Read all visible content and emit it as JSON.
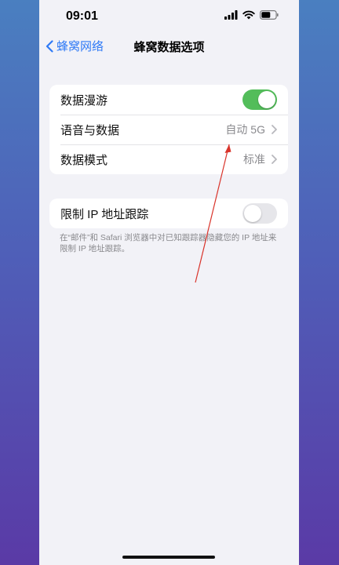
{
  "status_bar": {
    "time": "09:01"
  },
  "nav": {
    "back_label": "蜂窝网络",
    "title": "蜂窝数据选项"
  },
  "group1": {
    "data_roaming": {
      "label": "数据漫游",
      "toggle_on": true
    },
    "voice_data": {
      "label": "语音与数据",
      "value": "自动 5G"
    },
    "data_mode": {
      "label": "数据模式",
      "value": "标准"
    }
  },
  "group2": {
    "limit_ip": {
      "label": "限制 IP 地址跟踪",
      "toggle_on": false
    }
  },
  "footnote": "在“邮件”和 Safari 浏览器中对已知跟踪器隐藏您的 IP 地址来限制 IP 地址跟踪。",
  "colors": {
    "accent": "#2f7af6",
    "toggle_on": "#53bd5a",
    "annotation_arrow": "#d9342b"
  }
}
